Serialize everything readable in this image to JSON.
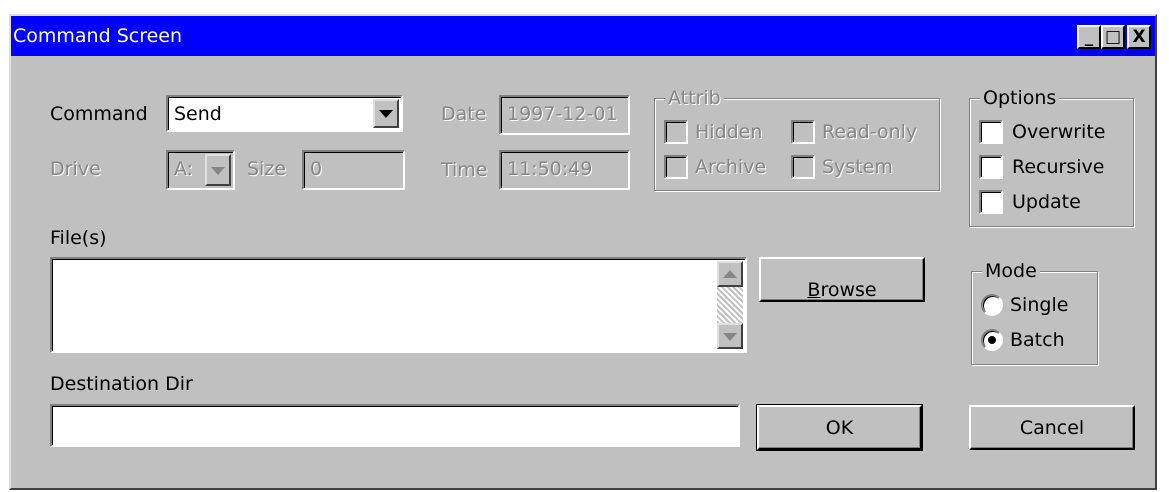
{
  "window": {
    "title": "Command Screen",
    "controls": {
      "minimize": "_",
      "maximize": "□",
      "close": "X"
    }
  },
  "command": {
    "label": "Command",
    "value": "Send"
  },
  "drive": {
    "label": "Drive",
    "value": "A:"
  },
  "size": {
    "label": "Size",
    "value": "0"
  },
  "date": {
    "label": "Date",
    "value": "1997-12-01"
  },
  "time": {
    "label": "Time",
    "value": "11:50:49"
  },
  "attrib": {
    "title": "Attrib",
    "hidden": {
      "label": "Hidden",
      "checked": false
    },
    "readonly": {
      "label": "Read-only",
      "checked": false
    },
    "archive": {
      "label": "Archive",
      "checked": false
    },
    "system": {
      "label": "System",
      "checked": false
    }
  },
  "options": {
    "title": "Options",
    "overwrite": {
      "label": "Overwrite",
      "checked": false
    },
    "recursive": {
      "label": "Recursive",
      "checked": false
    },
    "update": {
      "label": "Update",
      "checked": false
    }
  },
  "files": {
    "label": "File(s)",
    "value": ""
  },
  "browse": {
    "mnemonic": "B",
    "rest": "rowse"
  },
  "mode": {
    "title": "Mode",
    "single": {
      "label": "Single",
      "selected": false
    },
    "batch": {
      "label": "Batch",
      "selected": true
    }
  },
  "destination": {
    "label": "Destination Dir",
    "value": ""
  },
  "ok_label": "OK",
  "cancel_label": "Cancel",
  "colors": {
    "titlebar": "#0000ff",
    "face": "#c0c0c0",
    "disabled_text": "#868686"
  }
}
